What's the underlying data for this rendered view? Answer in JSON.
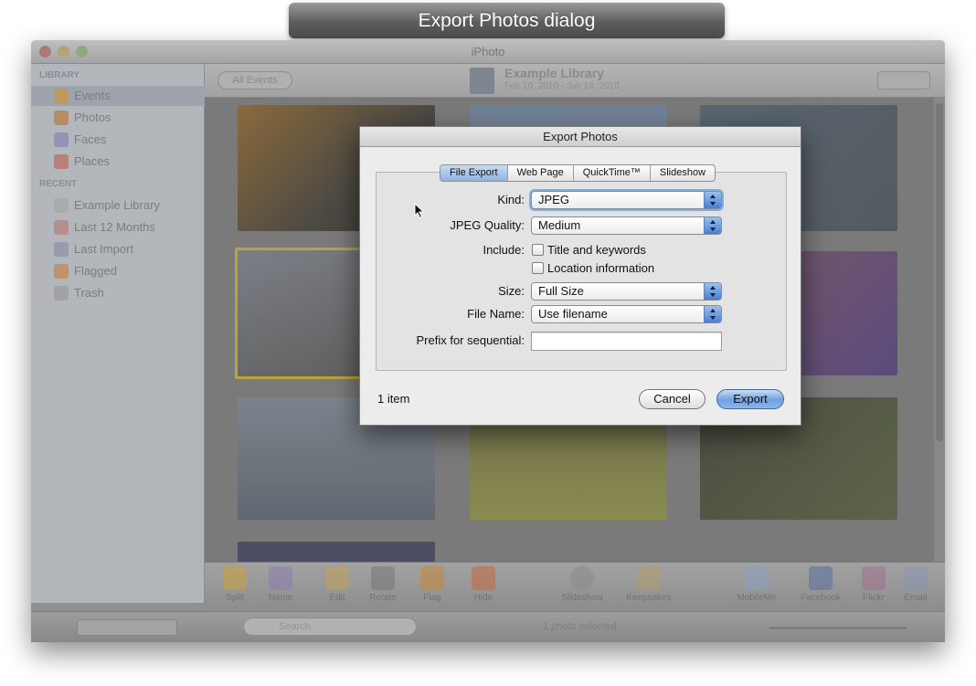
{
  "caption": "Export Photos dialog",
  "window": {
    "title": "iPhoto",
    "sidebar": {
      "library_heading": "LIBRARY",
      "library_items": [
        {
          "label": "Events",
          "icon": "events-icon",
          "color": "#c9943f",
          "selected": true
        },
        {
          "label": "Photos",
          "icon": "photos-icon",
          "color": "#b87c48"
        },
        {
          "label": "Faces",
          "icon": "faces-icon",
          "color": "#8b82b4"
        },
        {
          "label": "Places",
          "icon": "places-icon",
          "color": "#b66b5c"
        }
      ],
      "recent_heading": "RECENT",
      "recent_items": [
        {
          "label": "Example Library",
          "icon": "library-icon",
          "color": "#a6a6a6"
        },
        {
          "label": "Last 12 Months",
          "icon": "calendar-icon",
          "color": "#b37f7a"
        },
        {
          "label": "Last Import",
          "icon": "import-icon",
          "color": "#8a91a8"
        },
        {
          "label": "Flagged",
          "icon": "flag-icon",
          "color": "#c2864a"
        },
        {
          "label": "Trash",
          "icon": "trash-icon",
          "color": "#9a9a9a"
        }
      ]
    },
    "viewer": {
      "all_events_label": "All Events",
      "library_name": "Example Library",
      "library_dates": "Feb 10, 2010 - Jun 14, 2010"
    },
    "toolbar": {
      "tools": [
        {
          "label": "Split",
          "icon": "split-icon",
          "color": "#c9a23a"
        },
        {
          "label": "Name",
          "icon": "name-icon",
          "color": "#8a7db0"
        },
        {
          "label": "Edit",
          "icon": "edit-icon",
          "color": "#c0a05a"
        },
        {
          "label": "Rotate",
          "icon": "rotate-icon",
          "color": "#777777"
        },
        {
          "label": "Flag",
          "icon": "flag-icon",
          "color": "#c9863a"
        },
        {
          "label": "Hide",
          "icon": "hide-icon",
          "color": "#c46a3a"
        },
        {
          "label": "Slideshow",
          "icon": "slideshow-icon",
          "color": "#8a8a8a"
        },
        {
          "label": "Keepsakes",
          "icon": "keepsakes-icon",
          "color": "#b19a6a"
        },
        {
          "label": "MobileMe",
          "icon": "mobileme-icon",
          "color": "#8aa0c0"
        },
        {
          "label": "Facebook",
          "icon": "facebook-icon",
          "color": "#5a6fa0"
        },
        {
          "label": "Flickr",
          "icon": "flickr-icon",
          "color": "#a0708a"
        },
        {
          "label": "Email",
          "icon": "email-icon",
          "color": "#8a96b0"
        }
      ]
    },
    "bottom": {
      "search_placeholder": "Search",
      "status": "1 photo selected"
    }
  },
  "dialog": {
    "title": "Export Photos",
    "tabs": [
      {
        "label": "File Export",
        "active": true
      },
      {
        "label": "Web Page"
      },
      {
        "label": "QuickTime™"
      },
      {
        "label": "Slideshow"
      }
    ],
    "kind_label": "Kind:",
    "kind_value": "JPEG",
    "quality_label": "JPEG Quality:",
    "quality_value": "Medium",
    "include_label": "Include:",
    "include_options": [
      {
        "label": "Title and keywords",
        "checked": false
      },
      {
        "label": "Location information",
        "checked": false
      }
    ],
    "size_label": "Size:",
    "size_value": "Full Size",
    "filename_label": "File Name:",
    "filename_value": "Use filename",
    "prefix_label": "Prefix for sequential:",
    "prefix_value": "",
    "item_count": "1 item",
    "cancel_label": "Cancel",
    "export_label": "Export"
  }
}
